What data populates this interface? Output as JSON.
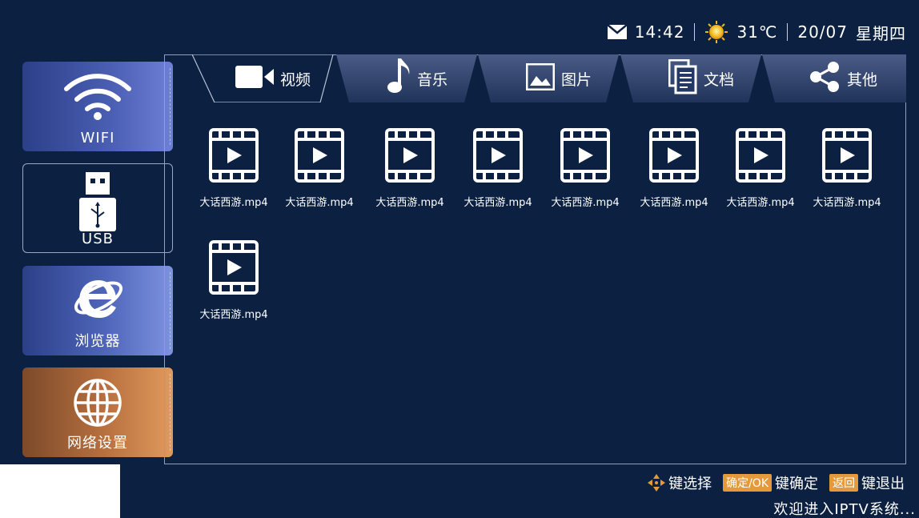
{
  "status": {
    "time": "14:42",
    "temperature": "31℃",
    "date": "20/07",
    "weekday": "星期四",
    "icons": [
      "mail-icon",
      "sun-icon"
    ]
  },
  "sidebar": {
    "items": [
      {
        "label": "WIFI",
        "icon": "wifi-icon"
      },
      {
        "label": "USB",
        "icon": "usb-icon"
      },
      {
        "label": "浏览器",
        "icon": "ie-browser-icon"
      },
      {
        "label": "网络设置",
        "icon": "globe-icon"
      }
    ]
  },
  "tabs": [
    {
      "label": "视频",
      "icon": "video-camera-icon",
      "active": true
    },
    {
      "label": "音乐",
      "icon": "music-note-icon",
      "active": false
    },
    {
      "label": "图片",
      "icon": "picture-icon",
      "active": false
    },
    {
      "label": "文档",
      "icon": "document-icon",
      "active": false
    },
    {
      "label": "其他",
      "icon": "share-icon",
      "active": false
    }
  ],
  "files": [
    {
      "name": "大话西游.mp4"
    },
    {
      "name": "大话西游.mp4"
    },
    {
      "name": "大话西游.mp4"
    },
    {
      "name": "大话西游.mp4"
    },
    {
      "name": "大话西游.mp4"
    },
    {
      "name": "大话西游.mp4"
    },
    {
      "name": "大话西游.mp4"
    },
    {
      "name": "大话西游.mp4"
    },
    {
      "name": "大话西游.mp4"
    }
  ],
  "footer": {
    "select_hint": "键选择",
    "ok_badge": "确定/OK",
    "ok_hint": "键确定",
    "back_badge": "返回",
    "back_hint": "键退出",
    "welcome": "欢迎进入IPTV系统..."
  },
  "colors": {
    "background": "#0c2142",
    "accent_orange": "#e49a3b",
    "sidebar_blue": "#4b5fb4",
    "sidebar_orange": "#b8703f"
  }
}
